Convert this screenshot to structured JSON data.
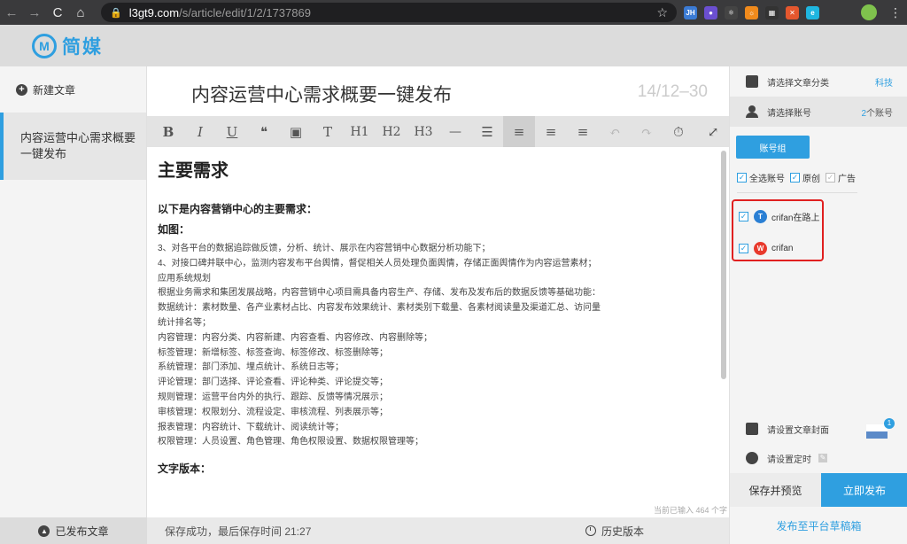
{
  "browser": {
    "url_host": "l3gt9.com",
    "url_path": "/s/article/edit/1/2/1737869",
    "back": "←",
    "forward": "→",
    "reload": "C",
    "home": "⌂",
    "lock": "🔒",
    "star": "☆",
    "menu": "⋮",
    "extensions": [
      {
        "label": "JH",
        "color": "#3b7bd4"
      },
      {
        "label": "●",
        "color": "#6b4fd0"
      },
      {
        "label": "⚛",
        "color": "#444"
      },
      {
        "label": "☼",
        "color": "#f08a1c"
      },
      {
        "label": "▦",
        "color": "#333"
      },
      {
        "label": "✕",
        "color": "#e4572e"
      },
      {
        "label": "e",
        "color": "#1fb6e0"
      }
    ]
  },
  "app": {
    "logo_mark": "M",
    "logo_text": "简媒"
  },
  "sidebar": {
    "new_article": "新建文章",
    "new_icon": "+",
    "article_title": "内容运营中心需求概要一键发布",
    "published_articles": "已发布文章",
    "published_icon": "▲"
  },
  "editor": {
    "title": "内容运营中心需求概要一键发布",
    "title_count": "14/12–30",
    "toolbar": [
      {
        "name": "bold-button",
        "label": "B"
      },
      {
        "name": "italic-button",
        "label": "I"
      },
      {
        "name": "underline-button",
        "label": "U"
      },
      {
        "name": "quote-button",
        "label": "❝"
      },
      {
        "name": "image-button",
        "label": "▣"
      },
      {
        "name": "text-style-button",
        "label": "T"
      },
      {
        "name": "h1-button",
        "label": "H1"
      },
      {
        "name": "h2-button",
        "label": "H2"
      },
      {
        "name": "h3-button",
        "label": "H3"
      },
      {
        "name": "hr-button",
        "label": "—"
      },
      {
        "name": "list-button",
        "label": "☰"
      },
      {
        "name": "align-left-button",
        "label": "≡"
      },
      {
        "name": "align-center-button",
        "label": "≡"
      },
      {
        "name": "align-right-button",
        "label": "≡"
      },
      {
        "name": "undo-button",
        "label": "↶"
      },
      {
        "name": "redo-button",
        "label": "↷"
      },
      {
        "name": "clock-button",
        "label": "⏱"
      },
      {
        "name": "fullscreen-button",
        "label": "⤢"
      }
    ],
    "heading": "主要需求",
    "intro": "以下是内容营销中心的主要需求：",
    "figure_label": "如图：",
    "lines": [
      "3、对各平台的数据追踪做反馈，分析、统计、展示在内容营销中心数据分析功能下；",
      "4、对接口碑并联中心，监测内容发布平台舆情，督促相关人员处理负面舆情，存储正面舆情作为内容运营素材；",
      "应用系统规划",
      "根据业务需求和集团发展战略，内容营销中心项目需具备内容生产、存储、发布及发布后的数据反馈等基础功能：",
      "数据统计：素材数量、各产业素材占比、内容发布效果统计、素材类别下载量、各素材阅读量及渠道汇总、访问量",
      "统计排名等；",
      "内容管理：内容分类、内容新建、内容查看、内容修改、内容删除等；",
      "标签管理：新增标签、标签查询、标签修改、标签删除等；",
      "系统管理：部门添加、埋点统计、系统日志等；",
      "评论管理：部门选择、评论查看、评论种类、评论提交等；",
      "规则管理：运营平台内外的执行、跟踪、反馈等情况展示；",
      "审核管理：权限划分、流程设定、审核流程、列表展示等；",
      "报表管理：内容统计、下载统计、阅读统计等；",
      "权限管理：人员设置、角色管理、角色权限设置、数据权限管理等；"
    ],
    "text_version": "文字版本：",
    "char_count": "当前已输入 464 个字",
    "save_status": "保存成功，最后保存时间 21:27",
    "history": "历史版本"
  },
  "right_panel": {
    "category_label": "请选择文章分类",
    "category_value": "科技",
    "account_label": "请选择账号",
    "account_count_num": "2",
    "account_count_text": "个账号",
    "account_group": "账号组",
    "select_all": "全选账号",
    "original": "原创",
    "ad": "广告",
    "accounts": [
      {
        "name": "crifan在路上",
        "icon": "T",
        "color": "#2a7fd4"
      },
      {
        "name": "crifan",
        "icon": "W",
        "color": "#e8392c"
      }
    ],
    "cover_label": "请设置文章封面",
    "cover_badge": "1",
    "timer_label": "请设置定时",
    "save_preview": "保存并预览",
    "publish_now": "立即发布",
    "publish_draft": "发布至平台草稿箱"
  },
  "colors": {
    "accent": "#2f9fe0",
    "highlight_border": "#e02020"
  }
}
